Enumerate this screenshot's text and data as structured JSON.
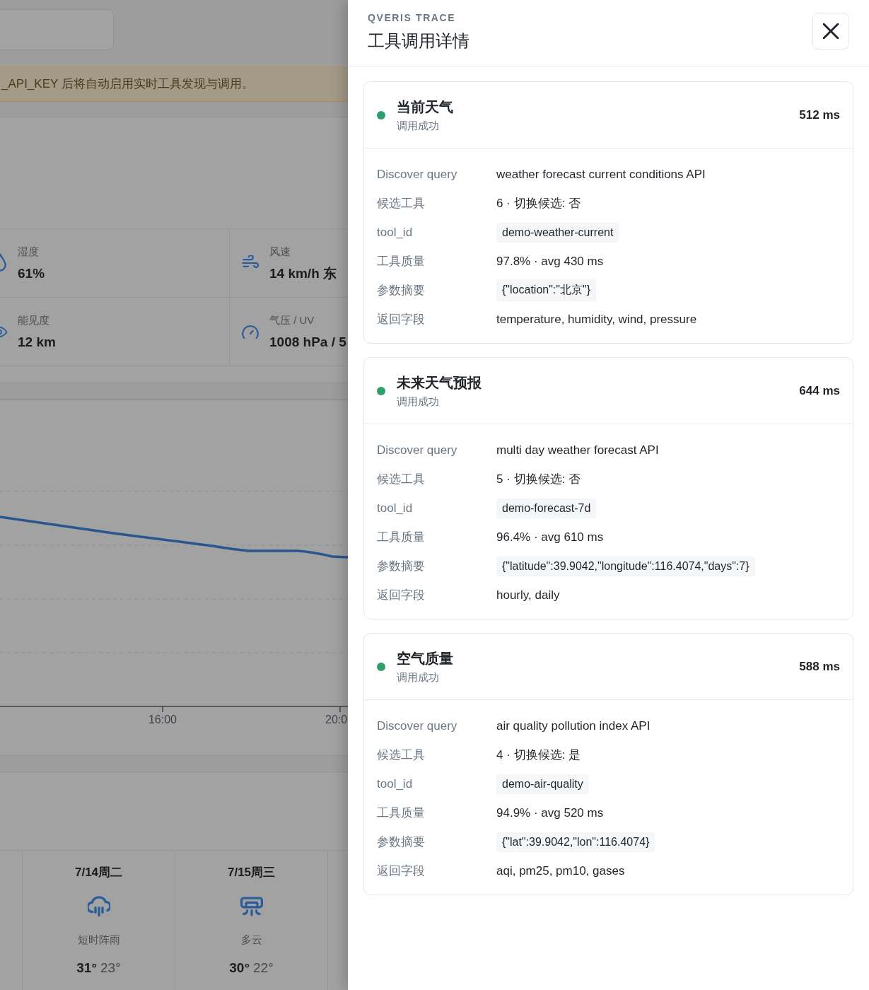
{
  "background_page": {
    "notice": "_API_KEY 后将自动启用实时工具发现与调用。",
    "stats": [
      {
        "kind": "humidity",
        "label": "湿度",
        "value": "61%"
      },
      {
        "kind": "wind",
        "label": "风速",
        "value": "14 km/h 东"
      },
      {
        "kind": "visibility",
        "label": "能见度",
        "value": "12 km"
      },
      {
        "kind": "pressure",
        "label": "气压 / UV",
        "value": "1008 hPa / 5"
      }
    ],
    "chart": {
      "x_labels": [
        "16:00",
        "20:0"
      ]
    },
    "forecast": [
      {
        "kind": "showers",
        "date": "7/14周二",
        "condition": "短时阵雨",
        "high": "31°",
        "low": "23°"
      },
      {
        "kind": "cloudy",
        "date": "7/15周三",
        "condition": "多云",
        "high": "30°",
        "low": "22°"
      }
    ]
  },
  "drawer": {
    "eyebrow": "QVERIS TRACE",
    "title": "工具调用详情",
    "calls": [
      {
        "name": "当前天气",
        "status": "调用成功",
        "color": "#2e9f6a",
        "duration": "512 ms",
        "fields": [
          {
            "kind": "text",
            "label": "Discover query",
            "value": "weather forecast current conditions API"
          },
          {
            "kind": "text",
            "label": "候选工具",
            "value": "6 · 切换候选: 否"
          },
          {
            "kind": "code",
            "label": "tool_id",
            "value": "demo-weather-current"
          },
          {
            "kind": "text",
            "label": "工具质量",
            "value": "97.8% · avg 430 ms"
          },
          {
            "kind": "code",
            "label": "参数摘要",
            "value": "{\"location\":\"北京\"}"
          },
          {
            "kind": "text",
            "label": "返回字段",
            "value": "temperature, humidity, wind, pressure"
          }
        ]
      },
      {
        "name": "未来天气预报",
        "status": "调用成功",
        "color": "#2e9f6a",
        "duration": "644 ms",
        "fields": [
          {
            "kind": "text",
            "label": "Discover query",
            "value": "multi day weather forecast API"
          },
          {
            "kind": "text",
            "label": "候选工具",
            "value": "5 · 切换候选: 否"
          },
          {
            "kind": "code",
            "label": "tool_id",
            "value": "demo-forecast-7d"
          },
          {
            "kind": "text",
            "label": "工具质量",
            "value": "96.4% · avg 610 ms"
          },
          {
            "kind": "code",
            "label": "参数摘要",
            "value": "{\"latitude\":39.9042,\"longitude\":116.4074,\"days\":7}"
          },
          {
            "kind": "text",
            "label": "返回字段",
            "value": "hourly, daily"
          }
        ]
      },
      {
        "name": "空气质量",
        "status": "调用成功",
        "color": "#2e9f6a",
        "duration": "588 ms",
        "fields": [
          {
            "kind": "text",
            "label": "Discover query",
            "value": "air quality pollution index API"
          },
          {
            "kind": "text",
            "label": "候选工具",
            "value": "4 · 切换候选: 是"
          },
          {
            "kind": "code",
            "label": "tool_id",
            "value": "demo-air-quality"
          },
          {
            "kind": "text",
            "label": "工具质量",
            "value": "94.9% · avg 520 ms"
          },
          {
            "kind": "code",
            "label": "参数摘要",
            "value": "{\"lat\":39.9042,\"lon\":116.4074}"
          },
          {
            "kind": "text",
            "label": "返回字段",
            "value": "aqi, pm25, pm10, gases"
          }
        ]
      }
    ]
  }
}
